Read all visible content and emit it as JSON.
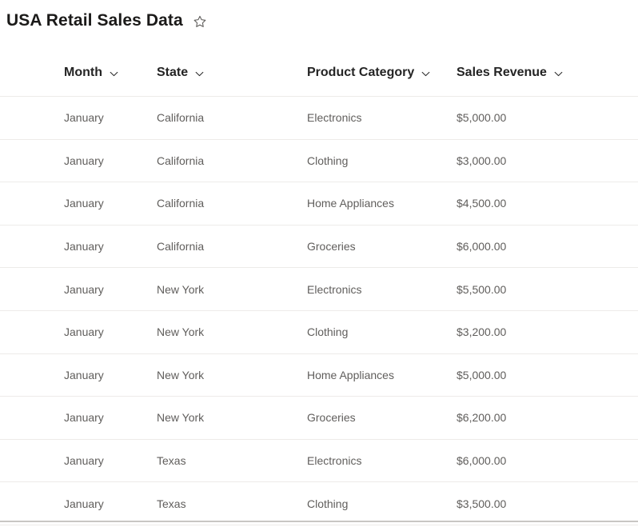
{
  "header": {
    "title": "USA Retail Sales Data",
    "favorite_icon": "star-outline-icon",
    "favorite_state": "not-favorited"
  },
  "table": {
    "sort_icon": "chevron-down-icon",
    "columns": [
      {
        "key": "month",
        "label": "Month"
      },
      {
        "key": "state",
        "label": "State"
      },
      {
        "key": "category",
        "label": "Product Category"
      },
      {
        "key": "revenue",
        "label": "Sales Revenue"
      }
    ],
    "rows": [
      {
        "month": "January",
        "state": "California",
        "category": "Electronics",
        "revenue": "$5,000.00"
      },
      {
        "month": "January",
        "state": "California",
        "category": "Clothing",
        "revenue": "$3,000.00"
      },
      {
        "month": "January",
        "state": "California",
        "category": "Home Appliances",
        "revenue": "$4,500.00"
      },
      {
        "month": "January",
        "state": "California",
        "category": "Groceries",
        "revenue": "$6,000.00"
      },
      {
        "month": "January",
        "state": "New York",
        "category": "Electronics",
        "revenue": "$5,500.00"
      },
      {
        "month": "January",
        "state": "New York",
        "category": "Clothing",
        "revenue": "$3,200.00"
      },
      {
        "month": "January",
        "state": "New York",
        "category": "Home Appliances",
        "revenue": "$5,000.00"
      },
      {
        "month": "January",
        "state": "New York",
        "category": "Groceries",
        "revenue": "$6,200.00"
      },
      {
        "month": "January",
        "state": "Texas",
        "category": "Electronics",
        "revenue": "$6,000.00"
      },
      {
        "month": "January",
        "state": "Texas",
        "category": "Clothing",
        "revenue": "$3,500.00"
      }
    ]
  },
  "colors": {
    "title_text": "#1b1a19",
    "header_text": "#242424",
    "cell_text": "#605e5c",
    "row_divider": "#edebe9",
    "footer_rule": "#c8c6c4",
    "background": "#ffffff"
  }
}
